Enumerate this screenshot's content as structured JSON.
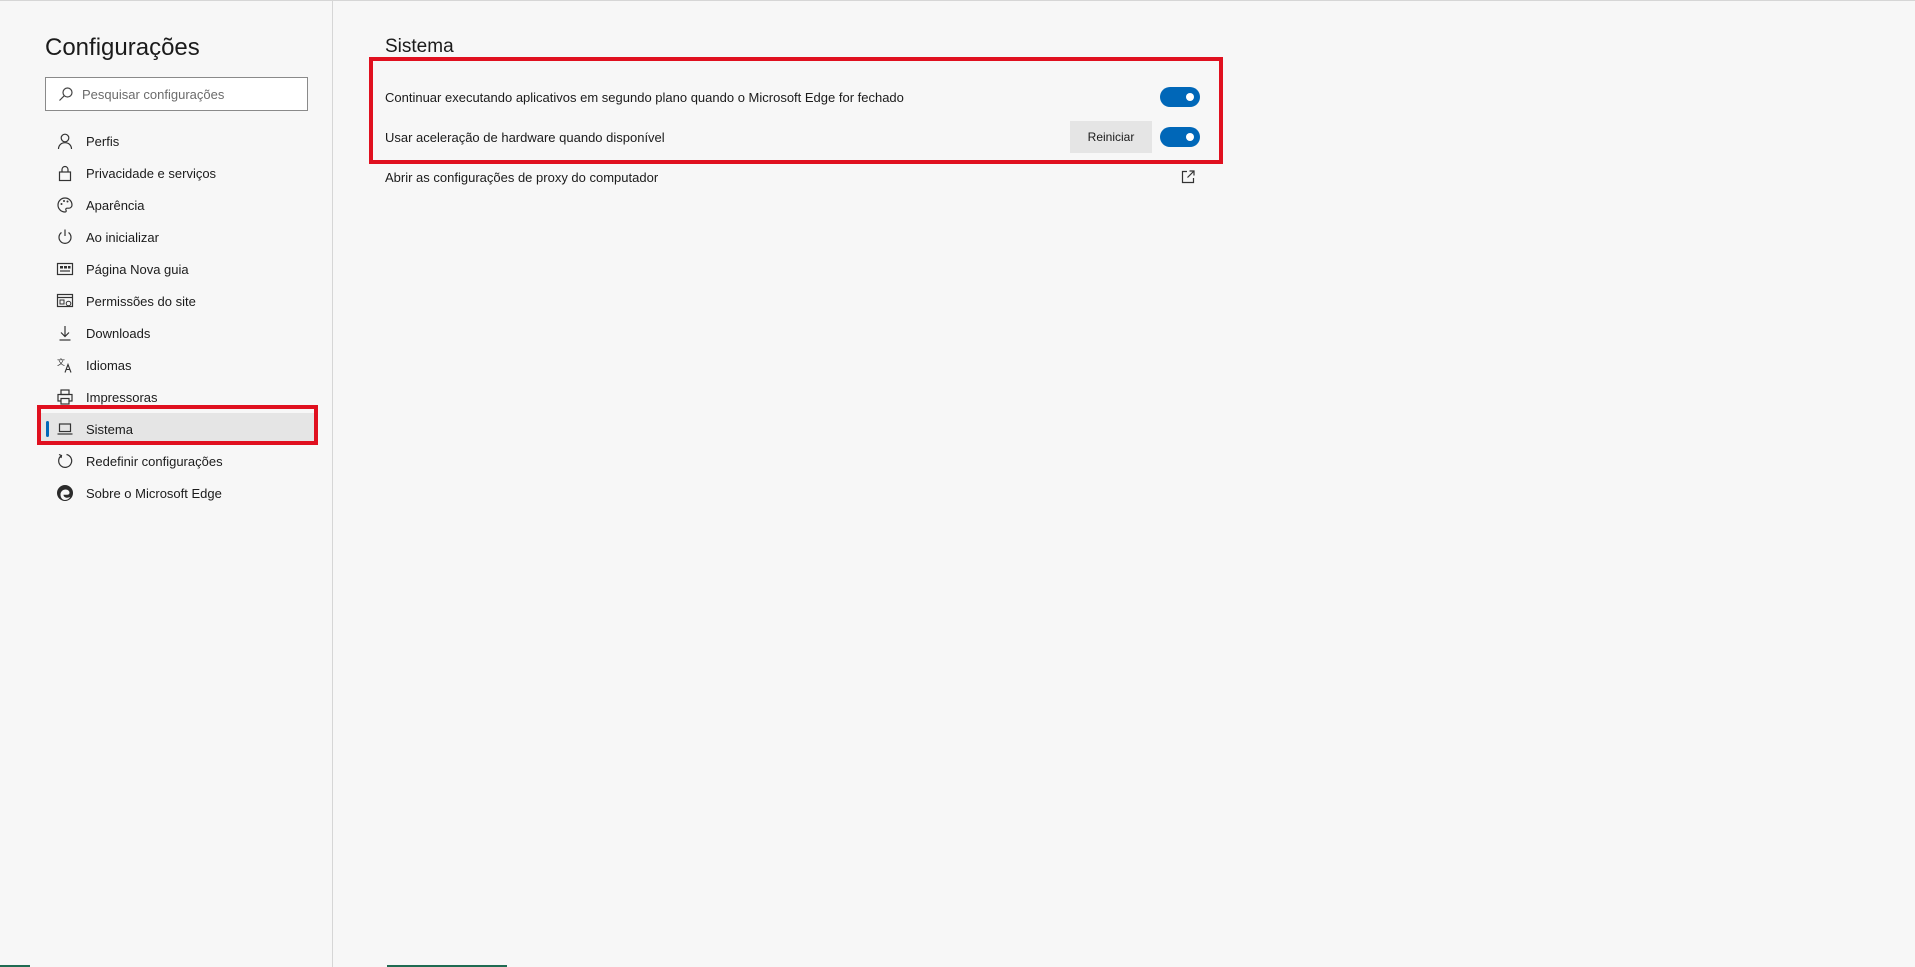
{
  "sidebar": {
    "title": "Configurações",
    "search": {
      "placeholder": "Pesquisar configurações",
      "value": ""
    },
    "items": [
      {
        "label": "Perfis",
        "icon": "person-icon"
      },
      {
        "label": "Privacidade e serviços",
        "icon": "lock-icon"
      },
      {
        "label": "Aparência",
        "icon": "palette-icon"
      },
      {
        "label": "Ao inicializar",
        "icon": "power-icon"
      },
      {
        "label": "Página Nova guia",
        "icon": "new-tab-page-icon"
      },
      {
        "label": "Permissões do site",
        "icon": "site-permissions-icon"
      },
      {
        "label": "Downloads",
        "icon": "download-icon"
      },
      {
        "label": "Idiomas",
        "icon": "languages-icon"
      },
      {
        "label": "Impressoras",
        "icon": "printer-icon"
      },
      {
        "label": "Sistema",
        "icon": "laptop-icon",
        "active": true
      },
      {
        "label": "Redefinir configurações",
        "icon": "reset-icon"
      },
      {
        "label": "Sobre o Microsoft Edge",
        "icon": "edge-logo-icon"
      }
    ]
  },
  "main": {
    "title": "Sistema",
    "settings": [
      {
        "label": "Continuar executando aplicativos em segundo plano quando o Microsoft Edge for fechado",
        "enabled": true
      },
      {
        "label": "Usar aceleração de hardware quando disponível",
        "enabled": true,
        "button_label": "Reiniciar"
      },
      {
        "label": "Abrir as configurações de proxy do computador",
        "icon": "external-link-icon"
      }
    ]
  },
  "colors": {
    "accent": "#0067b8",
    "highlight": "#e0101f",
    "background": "#f7f7f7",
    "active_item_bg": "#e5e5e5"
  }
}
